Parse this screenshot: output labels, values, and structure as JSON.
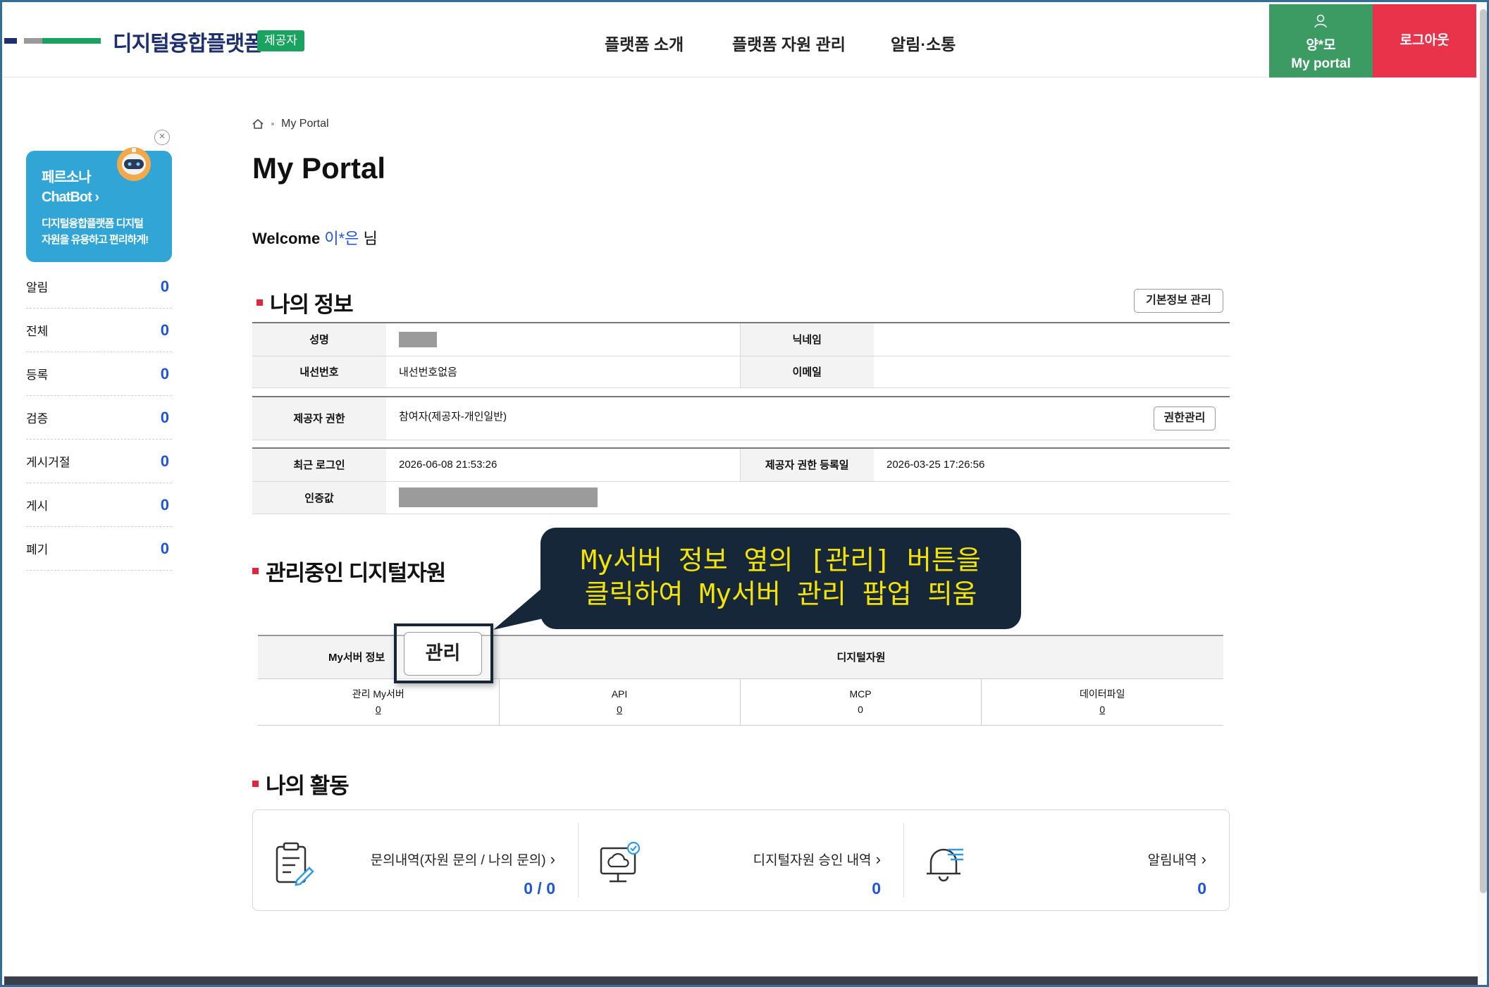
{
  "header": {
    "logo_text": "디지털융합플랫폼",
    "badge": "제공자",
    "nav": [
      "플랫폼 소개",
      "플랫폼 자원 관리",
      "알림·소통"
    ],
    "user_name": "양*모",
    "portal_label": "My portal",
    "logout_label": "로그아웃"
  },
  "chatbot": {
    "title_line1": "페르소나",
    "title_line2": "ChatBot",
    "arrow": "›",
    "desc_line1": "디지털융합플랫폼 디지털",
    "desc_line2": "자원을 유용하고 편리하게!",
    "close": "×"
  },
  "sidebar": {
    "items": [
      {
        "label": "알림",
        "count": "0"
      },
      {
        "label": "전체",
        "count": "0"
      },
      {
        "label": "등록",
        "count": "0"
      },
      {
        "label": "검증",
        "count": "0"
      },
      {
        "label": "게시거절",
        "count": "0"
      },
      {
        "label": "게시",
        "count": "0"
      },
      {
        "label": "폐기",
        "count": "0"
      }
    ]
  },
  "breadcrumb": {
    "current": "My Portal"
  },
  "page_title": "My Portal",
  "welcome": {
    "prefix": "Welcome",
    "name": "이*은",
    "suffix": "님"
  },
  "my_info": {
    "title": "나의 정보",
    "manage_button": "기본정보 관리",
    "labels": {
      "name": "성명",
      "nickname": "닉네임",
      "extension": "내선번호",
      "email": "이메일",
      "provider_role": "제공자 권한",
      "last_login": "최근 로그인",
      "role_date": "제공자 권한 등록일",
      "cert": "인증값"
    },
    "values": {
      "extension": "내선번호없음",
      "provider_role": "참여자(제공자-개인일반)",
      "last_login": "2026-06-08 21:53:26",
      "role_date": "2026-03-25 17:26:56"
    },
    "role_button": "권한관리"
  },
  "resources": {
    "title": "관리중인 디지털자원",
    "col_myserver": "My서버 정보",
    "col_digital": "디지털자원",
    "manage_button": "관리",
    "cells": [
      {
        "label": "관리 My서버",
        "value": "0"
      },
      {
        "label": "API",
        "value": "0"
      },
      {
        "label": "MCP",
        "value": "0"
      },
      {
        "label": "데이터파일",
        "value": "0"
      }
    ]
  },
  "callout": {
    "line1": "My서버 정보 옆의 [관리] 버튼을",
    "line2": "클릭하여 My서버 관리 팝업 띄움"
  },
  "activity": {
    "title": "나의 활동",
    "cards": [
      {
        "label": "문의내역(자원 문의 / 나의 문의)",
        "value": "0 / 0",
        "icon": "document-edit-icon"
      },
      {
        "label": "디지털자원 승인 내역",
        "value": "0",
        "icon": "monitor-cloud-check-icon"
      },
      {
        "label": "알림내역",
        "value": "0",
        "icon": "bell-list-icon"
      }
    ]
  },
  "colors": {
    "brand_navy": "#1d2f6e",
    "brand_green": "#1aa260",
    "portal_green": "#3c9a63",
    "logout_red": "#e8334a",
    "accent_blue": "#1e54d6",
    "callout_bg": "#16273a",
    "callout_text": "#f5e400"
  }
}
